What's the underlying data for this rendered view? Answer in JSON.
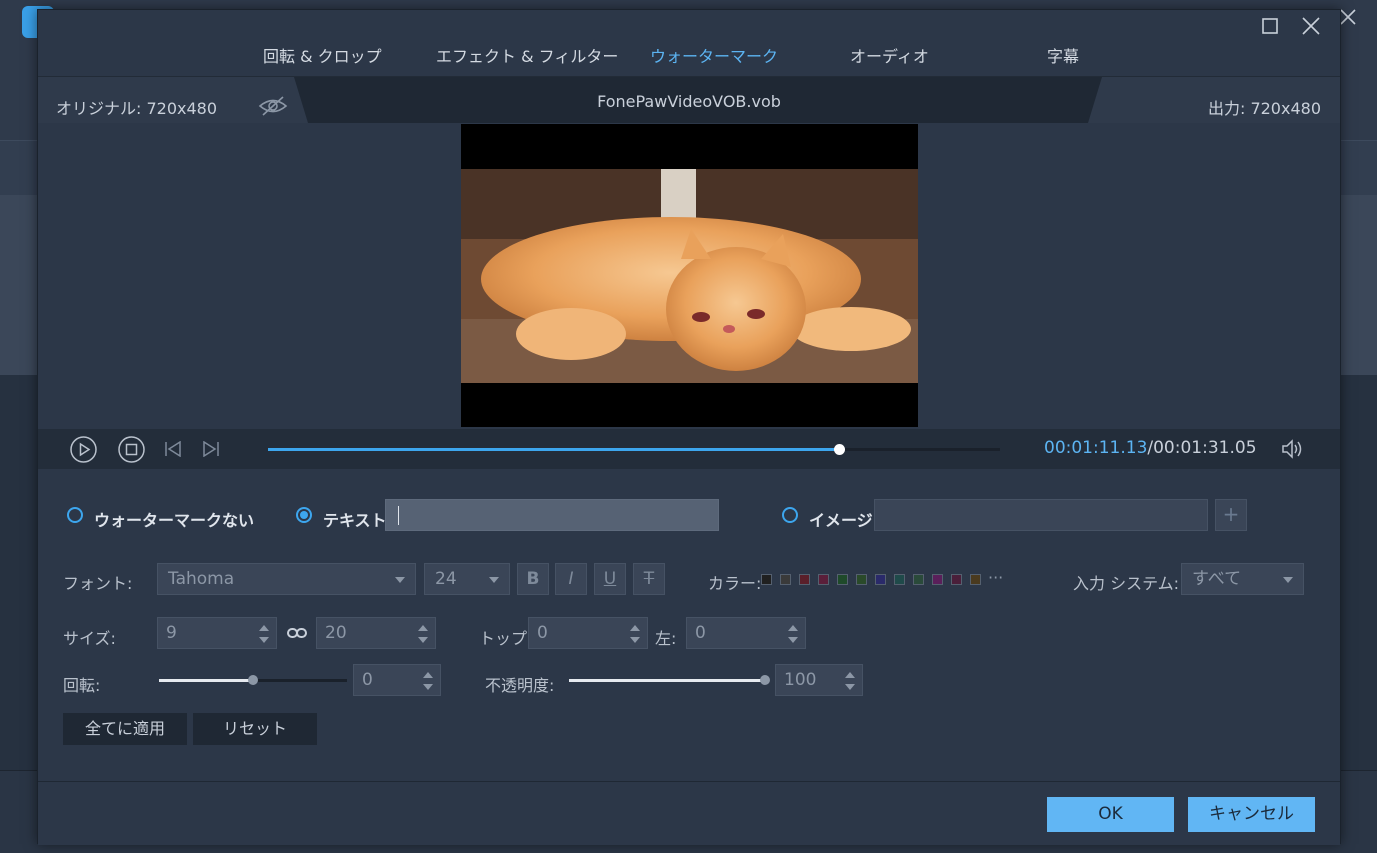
{
  "tabs": [
    {
      "label": "回転 & クロップ",
      "active": false
    },
    {
      "label": "エフェクト & フィルター",
      "active": false
    },
    {
      "label": "ウォーターマーク",
      "active": true
    },
    {
      "label": "オーディオ",
      "active": false
    },
    {
      "label": "字幕",
      "active": false
    }
  ],
  "infobar": {
    "original": "オリジナル: 720x480",
    "filename": "FonePawVideoVOB.vob",
    "output": "出力: 720x480"
  },
  "player": {
    "current_time": "00:01:11.13",
    "total_time": "/00:01:31.05",
    "progress": 0.78
  },
  "watermark": {
    "no_watermark_label": "ウォーターマークない",
    "text_label": "テキスト",
    "text_value": "",
    "image_label": "イメージ",
    "image_value": "",
    "add_image_glyph": "+",
    "selected": "text"
  },
  "font": {
    "label": "フォント:",
    "family": "Tahoma",
    "size": "24",
    "bold": "B",
    "italic": "I",
    "underline": "U",
    "strike": "T"
  },
  "color": {
    "label": "カラー:",
    "swatches": [
      "#202020",
      "#3a3a3a",
      "#5a1f2a",
      "#5a1f3a",
      "#1f4a2a",
      "#2a4a2a",
      "#2a2a6a",
      "#1f4a4a",
      "#2a4a3a",
      "#5a1f5a",
      "#4a1f3a",
      "#4a3a1f"
    ],
    "more": "···"
  },
  "input_system": {
    "label": "入力 システム:",
    "value": "すべて"
  },
  "size": {
    "label": "サイズ:",
    "width": "9",
    "height": "20"
  },
  "position": {
    "top_label": "トップ:",
    "top": "0",
    "left_label": "左:",
    "left": "0"
  },
  "rotation": {
    "label": "回転:",
    "value": "0",
    "slider_fraction": 0.5
  },
  "opacity": {
    "label": "不透明度:",
    "value": "100",
    "slider_fraction": 1.0
  },
  "actions": {
    "apply_all": "全てに適用",
    "reset": "リセット"
  },
  "footer": {
    "ok": "OK",
    "cancel": "キャンセル"
  },
  "colors": {
    "accent": "#5cb4f2",
    "button_primary": "#61b6f4",
    "dialog_bg": "#2c3748"
  }
}
